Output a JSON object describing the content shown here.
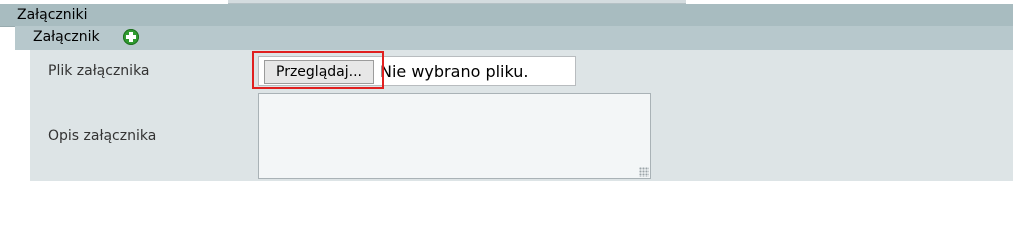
{
  "section": {
    "title": "Załączniki"
  },
  "attachment": {
    "title": "Załącznik",
    "add_icon": "plus-circle-green"
  },
  "form": {
    "file_label": "Plik załącznika",
    "browse_label": "Przeglądaj...",
    "file_status": "Nie wybrano pliku.",
    "description_label": "Opis załącznika",
    "description_value": ""
  },
  "colors": {
    "highlight": "#e02020",
    "panel_header": "#a8bcc0",
    "form_bg": "#dde4e6"
  }
}
